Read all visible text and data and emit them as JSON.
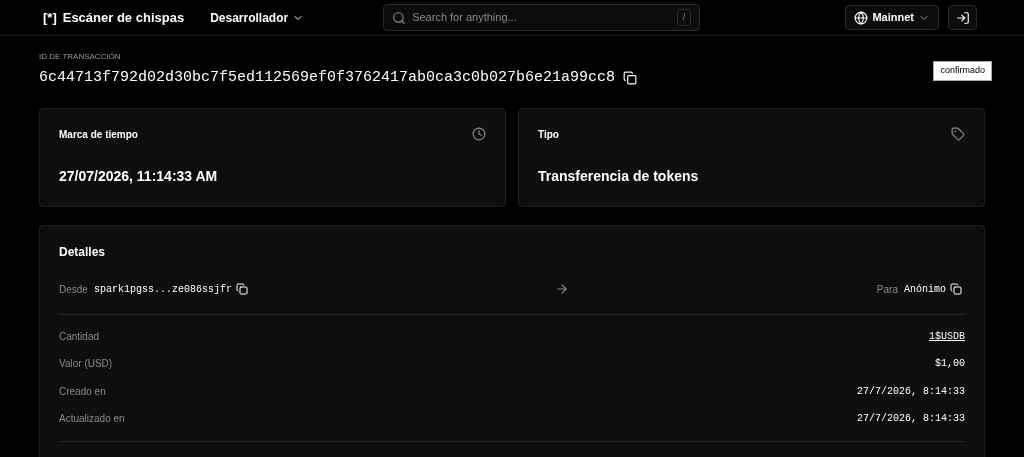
{
  "header": {
    "logo_mark": "[*]",
    "brand": "Escáner de chispas",
    "menu": "Desarrollador",
    "search": {
      "placeholder": "Search for anything...",
      "shortcut": "/"
    },
    "network": "Mainnet"
  },
  "transaction": {
    "label": "ID DE TRANSACCIÓN",
    "id": "6c44713f792d02d30bc7f5ed112569ef0f3762417ab0ca3c0b027b6e21a99cc8",
    "status": "confirmado"
  },
  "cards": [
    {
      "kind": "time",
      "label": "Marca de tiempo",
      "value": "27/07/2026, 11:14:33 AM"
    },
    {
      "kind": "type",
      "label": "Tipo",
      "value": "Transferencia de tokens"
    }
  ],
  "details": {
    "title": "Detalles",
    "from_label": "Desde",
    "from": "spark1pgss...ze086ssjfr",
    "to_label": "Para",
    "to": "Anónimo",
    "rows": [
      {
        "kind": "amount",
        "label": "Cantidad",
        "value": "1",
        "link": "$USDB"
      },
      {
        "kind": "plain",
        "label": "Valor (USD)",
        "value": "$1,00"
      },
      {
        "kind": "plain",
        "label": "Creado en",
        "value": "27/7/2026, 8:14:33"
      },
      {
        "kind": "plain",
        "label": "Actualizado en",
        "value": "27/7/2026, 8:14:33"
      }
    ]
  }
}
